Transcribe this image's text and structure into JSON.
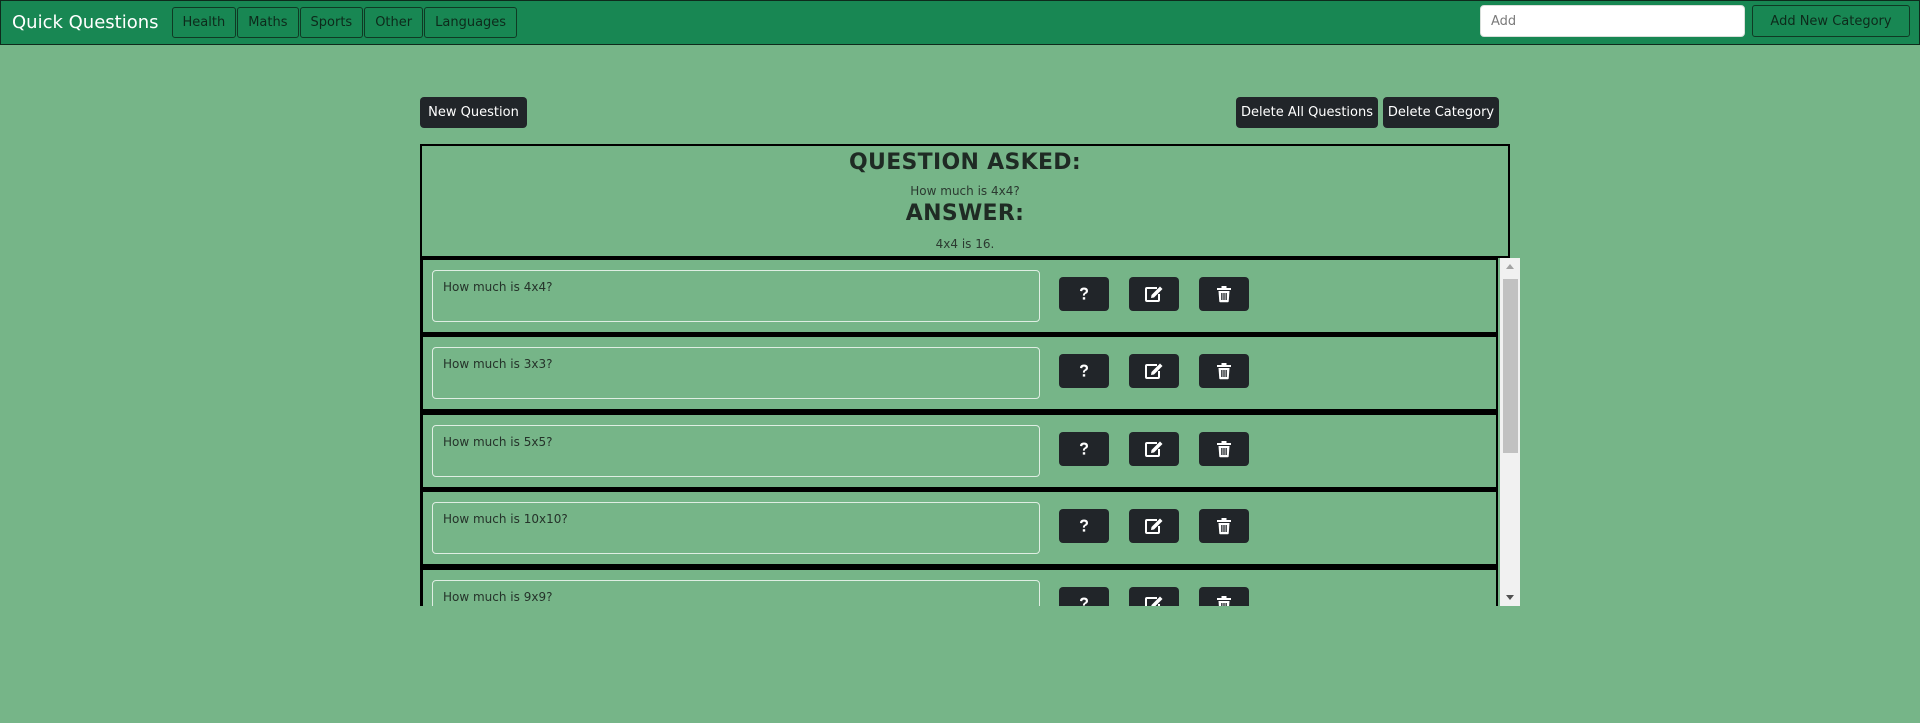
{
  "navbar": {
    "brand": "Quick Questions",
    "categories": [
      "Health",
      "Maths",
      "Sports",
      "Other",
      "Languages"
    ],
    "add_placeholder": "Add",
    "add_category_label": "Add New Category"
  },
  "toolbar": {
    "new_question_label": "New Question",
    "delete_all_label": "Delete All Questions",
    "delete_category_label": "Delete Category"
  },
  "panel": {
    "question_heading": "QUESTION ASKED:",
    "question_text": "How much is 4x4?",
    "answer_heading": "ANSWER:",
    "answer_text": "4x4 is 16."
  },
  "questions": [
    {
      "text": "How much is 4x4?"
    },
    {
      "text": "How much is 3x3?"
    },
    {
      "text": "How much is 5x5?"
    },
    {
      "text": "How much is 10x10?"
    },
    {
      "text": "How much is 9x9?"
    }
  ],
  "icons": {
    "ask": "question-icon",
    "edit": "edit-icon",
    "delete": "trash-icon"
  },
  "colors": {
    "background": "#76b588",
    "navbar": "#188753",
    "dark_button": "#212529"
  }
}
